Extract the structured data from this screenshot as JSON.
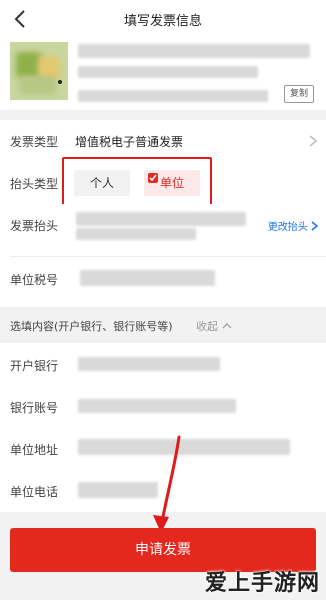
{
  "nav": {
    "title": "填写发票信息"
  },
  "store": {
    "copy_label": "复制"
  },
  "invoice_type": {
    "label": "发票类型",
    "value": "增值税电子普通发票"
  },
  "header_type": {
    "label": "抬头类型",
    "options": [
      "个人",
      "单位"
    ],
    "selected": "单位"
  },
  "invoice_header": {
    "label": "发票抬头",
    "change_link": "更改抬头"
  },
  "tax_id": {
    "label": "单位税号"
  },
  "optional": {
    "label": "选填内容(开户银行、银行账号等)",
    "collapse_label": "收起"
  },
  "bank": {
    "label": "开户银行"
  },
  "account": {
    "label": "银行账号"
  },
  "address": {
    "label": "单位地址"
  },
  "phone": {
    "label": "单位电话"
  },
  "submit": {
    "label": "申请发票"
  },
  "watermark": {
    "text": "爱上手游网"
  },
  "colors": {
    "accent": "#e4281d",
    "link": "#1a73e8",
    "highlight": "#e01b1b"
  }
}
